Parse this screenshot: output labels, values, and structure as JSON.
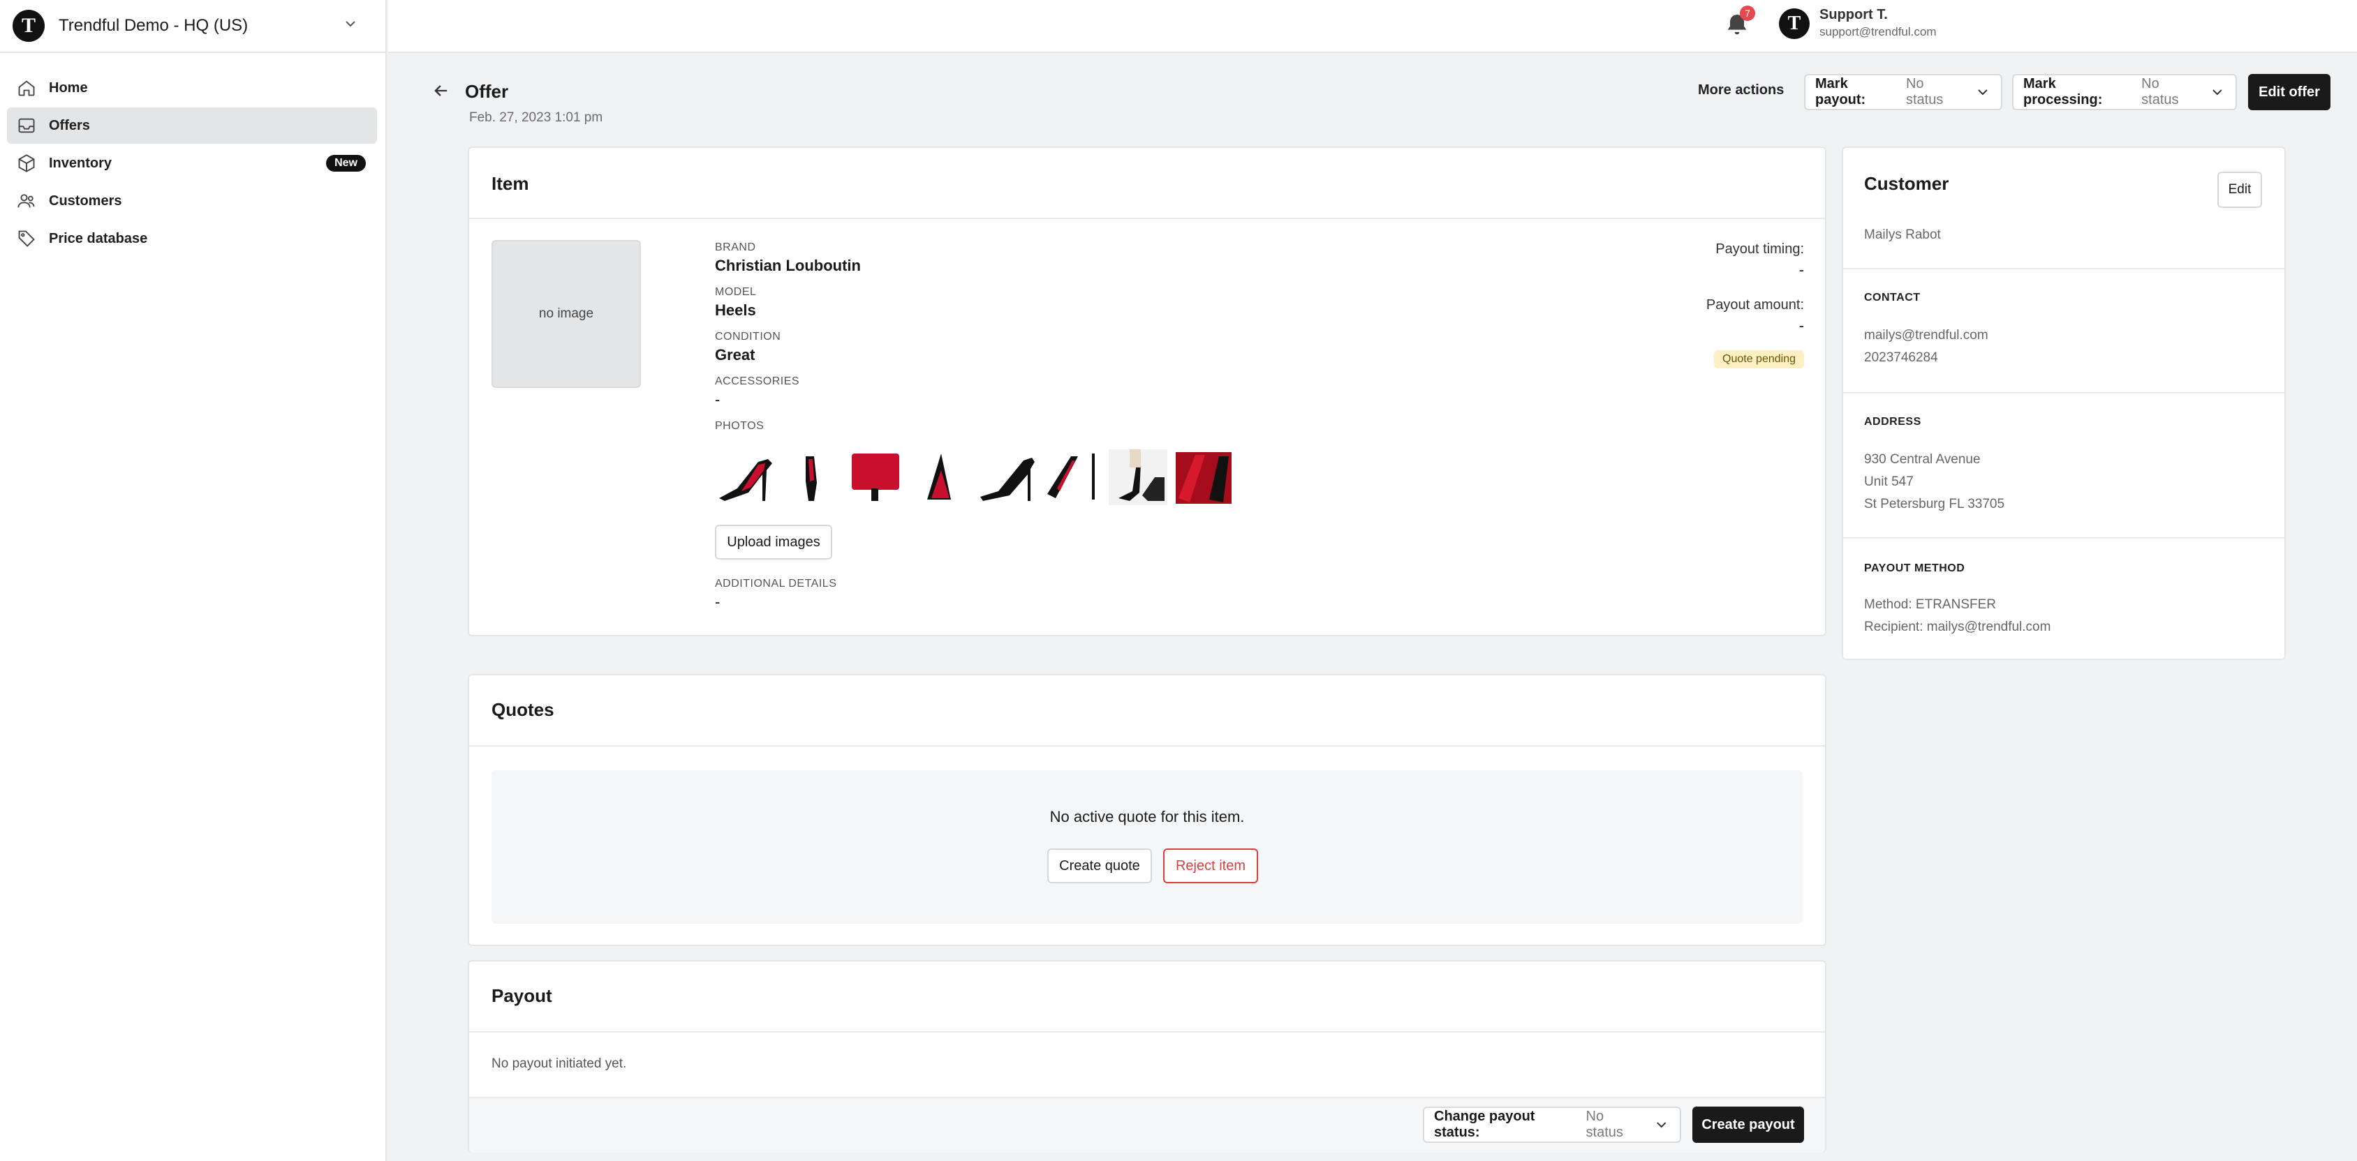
{
  "org": {
    "logo": "T",
    "name": "Trendful Demo - HQ (US)"
  },
  "nav": [
    {
      "label": "Home",
      "icon": "home-icon",
      "active": false
    },
    {
      "label": "Offers",
      "icon": "inbox-icon",
      "active": true
    },
    {
      "label": "Inventory",
      "icon": "box-icon",
      "active": false,
      "badge": "New"
    },
    {
      "label": "Customers",
      "icon": "users-icon",
      "active": false
    },
    {
      "label": "Price database",
      "icon": "tag-icon",
      "active": false
    }
  ],
  "topbar": {
    "notifications_count": "7",
    "avatar": "T",
    "user_name": "Support T.",
    "user_email": "support@trendful.com"
  },
  "header": {
    "title": "Offer",
    "date": "Feb. 27, 2023 1:01 pm",
    "more_actions": "More actions",
    "mark_payout_label": "Mark payout:",
    "mark_payout_value": "No status",
    "mark_processing_label": "Mark processing:",
    "mark_processing_value": "No status",
    "edit_offer": "Edit offer"
  },
  "item": {
    "title": "Item",
    "no_image": "no image",
    "brand_label": "BRAND",
    "brand": "Christian Louboutin",
    "model_label": "MODEL",
    "model": "Heels",
    "condition_label": "CONDITION",
    "condition": "Great",
    "accessories_label": "ACCESSORIES",
    "accessories": "-",
    "photos_label": "PHOTOS",
    "upload_images": "Upload images",
    "additional_label": "ADDITIONAL DETAILS",
    "additional": "-",
    "payout_timing_label": "Payout timing:",
    "payout_timing": "-",
    "payout_amount_label": "Payout amount:",
    "payout_amount": "-",
    "status": "Quote pending"
  },
  "quotes": {
    "title": "Quotes",
    "empty": "No active quote for this item.",
    "create_quote": "Create quote",
    "reject_item": "Reject item"
  },
  "payout": {
    "title": "Payout",
    "empty": "No payout initiated yet.",
    "change_status_label": "Change payout status:",
    "change_status_value": "No status",
    "create_payout": "Create payout"
  },
  "customer": {
    "title": "Customer",
    "edit": "Edit",
    "name": "Mailys Rabot",
    "contact_head": "CONTACT",
    "email": "mailys@trendful.com",
    "phone": "2023746284",
    "address_head": "ADDRESS",
    "address1": "930 Central Avenue",
    "address2": "Unit 547",
    "address3": "St Petersburg FL 33705",
    "payout_head": "PAYOUT METHOD",
    "method": "Method: ETRANSFER",
    "recipient": "Recipient: mailys@trendful.com"
  },
  "colors": {
    "accent_dark": "#1a1a1a",
    "danger": "#d93f3f",
    "pending_bg": "#fdf0c4"
  }
}
